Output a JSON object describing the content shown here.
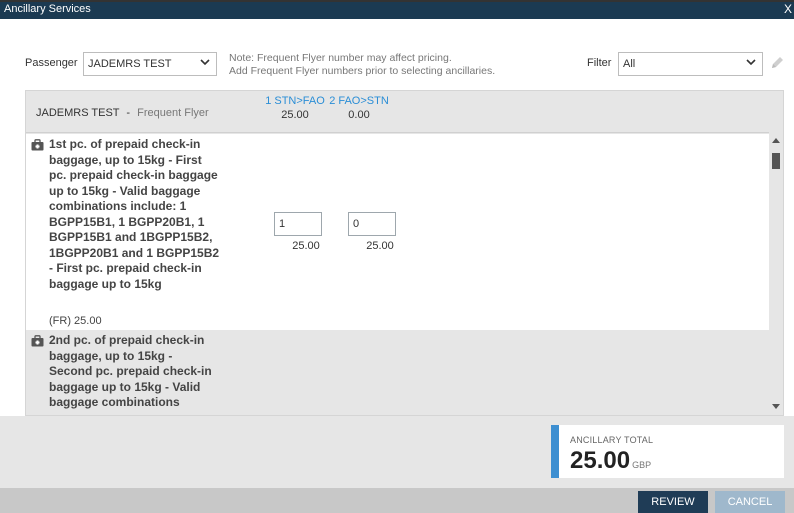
{
  "window": {
    "title": "Ancillary Services",
    "close_label": "X"
  },
  "toolbar": {
    "passenger_label": "Passenger",
    "passenger_value": "JADEMRS TEST",
    "note_line1": "Note: Frequent Flyer number may affect pricing.",
    "note_line2": "Add Frequent Flyer numbers prior to selecting ancillaries.",
    "filter_label": "Filter",
    "filter_value": "All"
  },
  "table": {
    "passenger_name": "JADEMRS TEST",
    "separator": "-",
    "frequent_flyer_label": "Frequent Flyer",
    "segments": [
      {
        "code": "1 STN>FAO",
        "amount": "25.00"
      },
      {
        "code": "2 FAO>STN",
        "amount": "0.00"
      }
    ],
    "rows": [
      {
        "lines": [
          "1st pc. of prepaid check-in",
          "baggage, up to 15kg - First",
          "pc. prepaid check-in baggage",
          "up to 15kg - Valid baggage",
          "combinations include: 1",
          "BGPP15B1, 1 BGPP20B1, 1",
          "BGPP15B1 and 1BGPP15B2,",
          "1BGPP20B1 and 1 BGPP15B2",
          "- First pc. prepaid check-in",
          "baggage up to 15kg"
        ],
        "price": "(FR) 25.00",
        "qty": [
          "1",
          "0"
        ],
        "qty_prices": [
          "25.00",
          "25.00"
        ]
      },
      {
        "lines": [
          "2nd pc. of prepaid check-in",
          "baggage, up to 15kg -",
          "Second pc. prepaid check-in",
          "baggage up to 15kg - Valid",
          "baggage combinations"
        ]
      }
    ]
  },
  "total": {
    "label": "ANCILLARY TOTAL",
    "value": "25.00",
    "currency": "GBP"
  },
  "buttons": {
    "review": "REVIEW",
    "cancel": "CANCEL"
  },
  "colors": {
    "title_bar": "#1b3a52",
    "link_blue": "#2b8ed6",
    "accent_bar": "#3d8fd1",
    "review_button": "#1f3c56",
    "cancel_button": "#9fb8cc"
  }
}
